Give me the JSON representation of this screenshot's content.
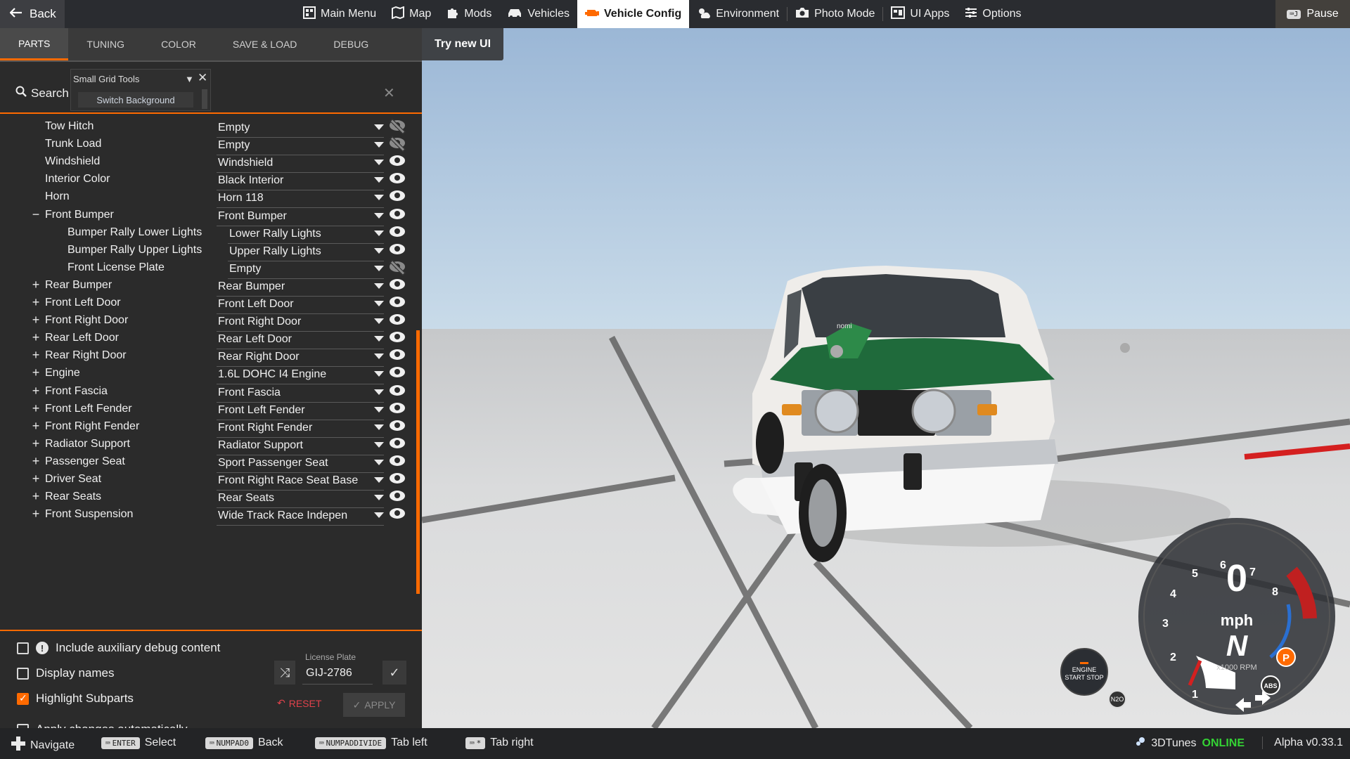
{
  "topbar": {
    "back_label": "Back",
    "pause_label": "Pause",
    "nav": [
      {
        "label": "Main Menu",
        "icon": "grid-icon",
        "active": false
      },
      {
        "label": "Map",
        "icon": "map-icon",
        "active": false
      },
      {
        "label": "Mods",
        "icon": "puzzle-icon",
        "active": false
      },
      {
        "label": "Vehicles",
        "icon": "car-icon",
        "active": false
      },
      {
        "label": "Vehicle Config",
        "icon": "engine-icon",
        "active": true
      },
      {
        "label": "Environment",
        "icon": "weather-icon",
        "active": false
      },
      {
        "label": "Photo Mode",
        "icon": "camera-icon",
        "active": false
      },
      {
        "label": "UI Apps",
        "icon": "apps-icon",
        "active": false
      },
      {
        "label": "Options",
        "icon": "sliders-icon",
        "active": false
      }
    ]
  },
  "tabs": [
    "PARTS",
    "TUNING",
    "COLOR",
    "SAVE & LOAD",
    "DEBUG"
  ],
  "active_tab": "PARTS",
  "try_new_ui": "Try new UI",
  "search": {
    "label": "Search",
    "value": "",
    "placeholder": ""
  },
  "grid_tools": {
    "title": "Small Grid Tools",
    "button": "Switch Background"
  },
  "parts": [
    {
      "name": "Tow Hitch",
      "value": "Empty",
      "indent": 0,
      "expander": "",
      "visible": false
    },
    {
      "name": "Trunk Load",
      "value": "Empty",
      "indent": 0,
      "expander": "",
      "visible": false
    },
    {
      "name": "Windshield",
      "value": "Windshield",
      "indent": 0,
      "expander": "",
      "visible": true
    },
    {
      "name": "Interior Color",
      "value": "Black Interior",
      "indent": 0,
      "expander": "",
      "visible": true
    },
    {
      "name": "Horn",
      "value": "Horn 118",
      "indent": 0,
      "expander": "",
      "visible": true
    },
    {
      "name": "Front Bumper",
      "value": "Front Bumper",
      "indent": 0,
      "expander": "−",
      "visible": true
    },
    {
      "name": "Bumper Rally Lower Lights",
      "value": "Lower Rally Lights",
      "indent": 1,
      "expander": "",
      "visible": true
    },
    {
      "name": "Bumper Rally Upper Lights",
      "value": "Upper Rally Lights",
      "indent": 1,
      "expander": "",
      "visible": true
    },
    {
      "name": "Front License Plate",
      "value": "Empty",
      "indent": 1,
      "expander": "",
      "visible": false
    },
    {
      "name": "Rear Bumper",
      "value": "Rear Bumper",
      "indent": 0,
      "expander": "+",
      "visible": true
    },
    {
      "name": "Front Left Door",
      "value": "Front Left Door",
      "indent": 0,
      "expander": "+",
      "visible": true
    },
    {
      "name": "Front Right Door",
      "value": "Front Right Door",
      "indent": 0,
      "expander": "+",
      "visible": true
    },
    {
      "name": "Rear Left Door",
      "value": "Rear Left Door",
      "indent": 0,
      "expander": "+",
      "visible": true
    },
    {
      "name": "Rear Right Door",
      "value": "Rear Right Door",
      "indent": 0,
      "expander": "+",
      "visible": true
    },
    {
      "name": "Engine",
      "value": "1.6L DOHC I4 Engine",
      "indent": 0,
      "expander": "+",
      "visible": true
    },
    {
      "name": "Front Fascia",
      "value": "Front Fascia",
      "indent": 0,
      "expander": "+",
      "visible": true
    },
    {
      "name": "Front Left Fender",
      "value": "Front Left Fender",
      "indent": 0,
      "expander": "+",
      "visible": true
    },
    {
      "name": "Front Right Fender",
      "value": "Front Right Fender",
      "indent": 0,
      "expander": "+",
      "visible": true
    },
    {
      "name": "Radiator Support",
      "value": "Radiator Support",
      "indent": 0,
      "expander": "+",
      "visible": true
    },
    {
      "name": "Passenger Seat",
      "value": "Sport Passenger Seat",
      "indent": 0,
      "expander": "+",
      "visible": true
    },
    {
      "name": "Driver Seat",
      "value": "Front Right Race Seat Base",
      "indent": 0,
      "expander": "+",
      "visible": true
    },
    {
      "name": "Rear Seats",
      "value": "Rear Seats",
      "indent": 0,
      "expander": "+",
      "visible": true
    },
    {
      "name": "Front Suspension",
      "value": "Wide Track Race Indepen",
      "indent": 0,
      "expander": "+",
      "visible": true
    }
  ],
  "options": {
    "aux_debug": {
      "label": "Include auxiliary debug content",
      "checked": false
    },
    "display_names": {
      "label": "Display names",
      "checked": false
    },
    "highlight_subparts": {
      "label": "Highlight Subparts",
      "checked": true
    },
    "apply_auto": {
      "label": "Apply changes automatically",
      "checked": false
    }
  },
  "license_plate": {
    "label": "License Plate",
    "value": "GIJ-2786"
  },
  "reset_label": "RESET",
  "apply_label": "APPLY",
  "gauge": {
    "speed": "0",
    "speed_unit": "mph",
    "gear": "N",
    "rpm_unit": "x1000 RPM",
    "rpm_ticks": [
      "1",
      "2",
      "3",
      "4",
      "5",
      "6",
      "7",
      "8"
    ],
    "parking_label": "P",
    "abs_label": "ABS"
  },
  "engine_button": "ENGINE START STOP",
  "nos_label": "N2O",
  "car_sticker": "nomi",
  "bottombar": {
    "hints": [
      {
        "key": "",
        "label": "Navigate"
      },
      {
        "key": "ENTER",
        "label": "Select"
      },
      {
        "key": "NUMPAD0",
        "label": "Back"
      },
      {
        "key": "NUMPADDIVIDE",
        "label": "Tab left"
      },
      {
        "key": "*",
        "label": "Tab right"
      }
    ],
    "station": "3DTunes",
    "online": "ONLINE",
    "version": "Alpha v0.33.1"
  },
  "colors": {
    "accent": "#ff6a00",
    "car_green": "#1f6a3b",
    "online_green": "#34d334",
    "reset_red": "#e0424b"
  }
}
